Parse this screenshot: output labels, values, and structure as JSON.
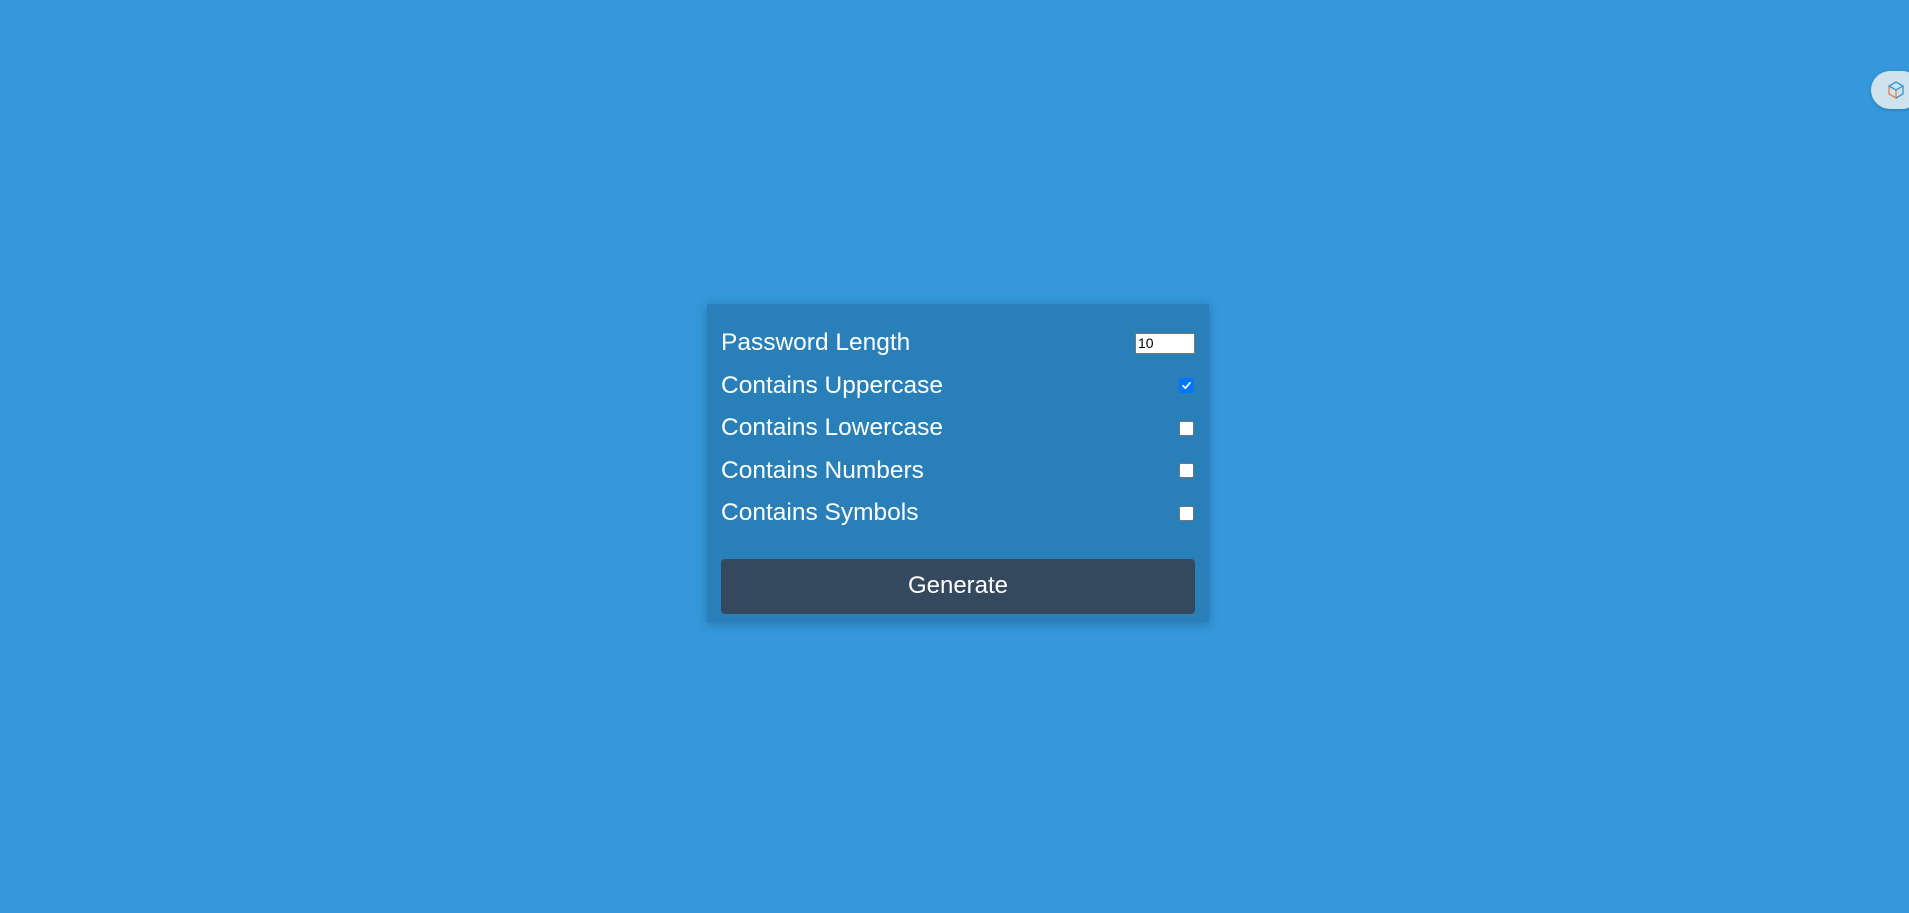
{
  "form": {
    "length_label": "Password Length",
    "length_value": "10",
    "options": [
      {
        "label": "Contains Uppercase",
        "checked": true
      },
      {
        "label": "Contains Lowercase",
        "checked": false
      },
      {
        "label": "Contains Numbers",
        "checked": false
      },
      {
        "label": "Contains Symbols",
        "checked": false
      }
    ],
    "generate_label": "Generate"
  },
  "colors": {
    "page_background": "#3498db",
    "card_background": "#2980b9",
    "button_background": "#34495e",
    "checkbox_accent": "#0075ff"
  },
  "extension": {
    "icon": "cube-extension-icon"
  }
}
